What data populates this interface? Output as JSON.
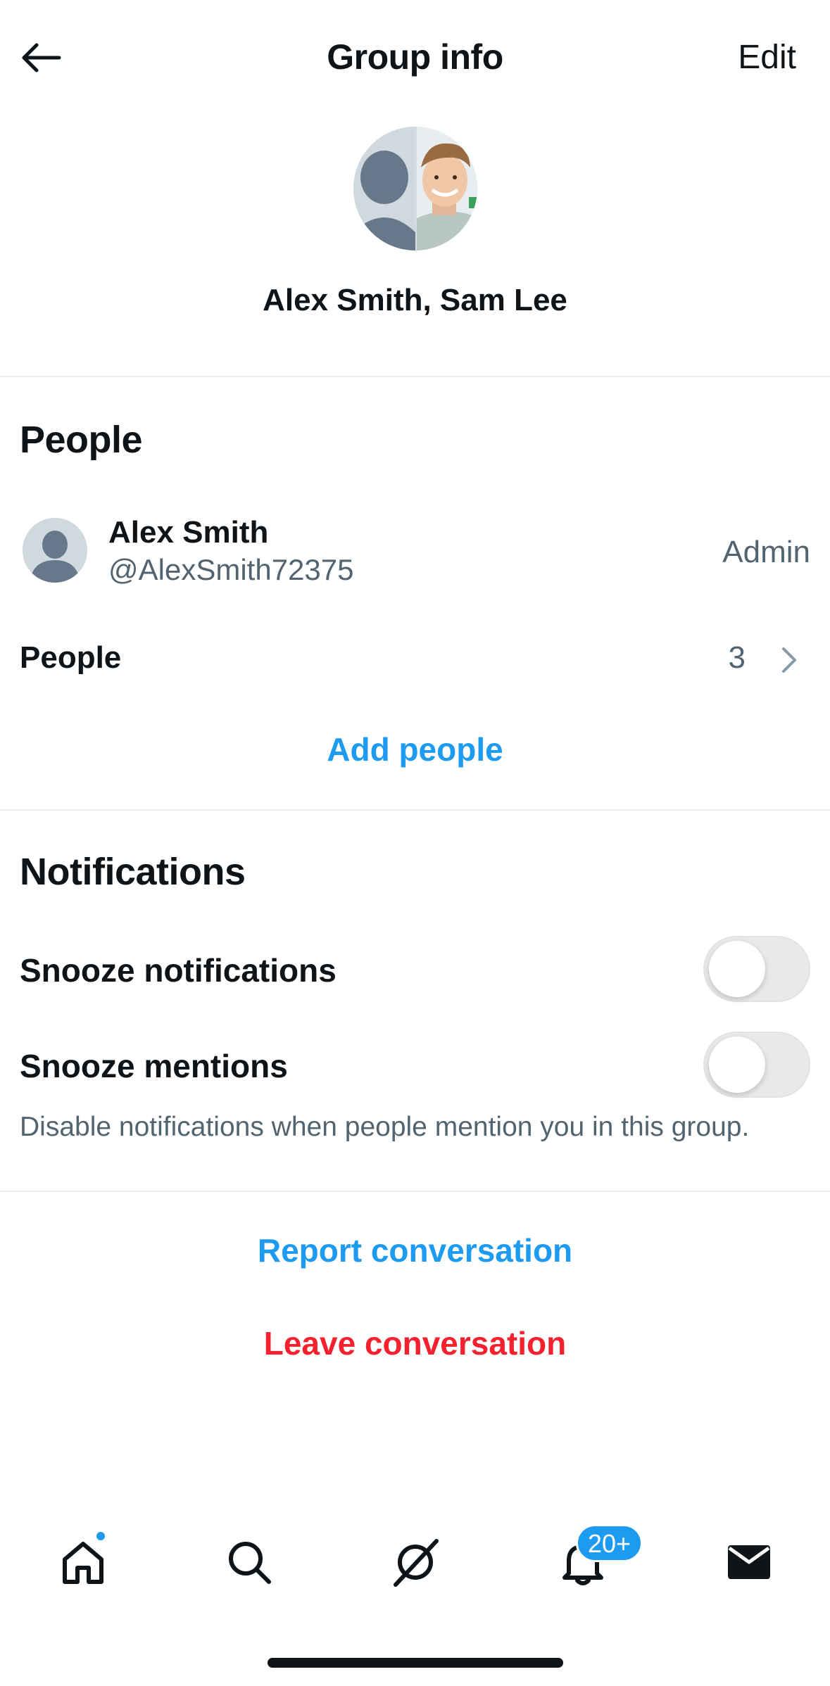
{
  "header": {
    "title": "Group info",
    "edit_label": "Edit"
  },
  "group": {
    "name": "Alex Smith, Sam Lee"
  },
  "people_section": {
    "title": "People",
    "members": [
      {
        "name": "Alex Smith",
        "handle": "@AlexSmith72375",
        "role": "Admin"
      }
    ],
    "people_row_label": "People",
    "people_count": "3",
    "add_people_label": "Add people"
  },
  "notifications_section": {
    "title": "Notifications",
    "snooze_notifications_label": "Snooze notifications",
    "snooze_notifications_on": false,
    "snooze_mentions_label": "Snooze mentions",
    "snooze_mentions_on": false,
    "help_text": "Disable notifications when people mention you in this group."
  },
  "actions": {
    "report_label": "Report conversation",
    "leave_label": "Leave conversation"
  },
  "tabbar": {
    "items": [
      "home-icon",
      "search-icon",
      "grok-icon",
      "bell-icon",
      "mail-icon"
    ],
    "notifications_badge": "20+"
  },
  "colors": {
    "accent": "#1d9bf0",
    "danger": "#f4212e",
    "secondary_text": "#536471"
  }
}
